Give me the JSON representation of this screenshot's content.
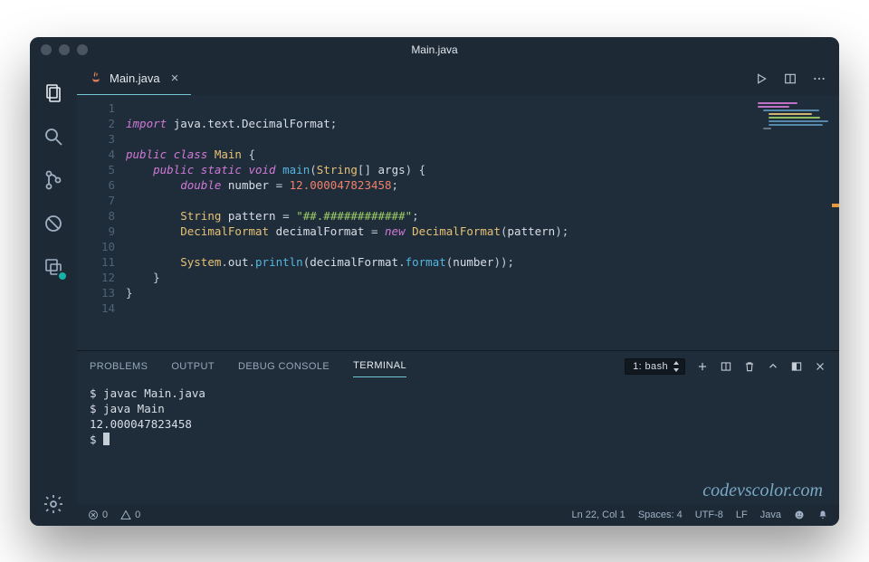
{
  "window": {
    "title": "Main.java"
  },
  "tabs": {
    "open": {
      "filename": "Main.java"
    },
    "actions": {
      "run": "run-icon",
      "split": "split-icon",
      "more": "more-icon"
    }
  },
  "activitybar": {
    "items": [
      "explorer-icon",
      "search-icon",
      "source-control-icon",
      "debug-icon",
      "remote-icon"
    ],
    "bottom": [
      "settings-gear-icon"
    ]
  },
  "editor": {
    "line_numbers": [
      "1",
      "2",
      "3",
      "4",
      "5",
      "6",
      "7",
      "8",
      "9",
      "10",
      "11",
      "12",
      "13",
      "14"
    ],
    "code": {
      "l2_import": "import",
      "l2_pkg": "java.text.DecimalFormat",
      "l4_public": "public",
      "l4_class": "class",
      "l4_name": "Main",
      "l5_public": "public",
      "l5_static": "static",
      "l5_void": "void",
      "l5_main": "main",
      "l5_String": "String",
      "l5_args": "args",
      "l6_double": "double",
      "l6_var": "number",
      "l6_eq": "=",
      "l6_val": "12.000047823458",
      "l8_String": "String",
      "l8_var": "pattern",
      "l8_eq": "=",
      "l8_val": "\"##.############\"",
      "l9_Type": "DecimalFormat",
      "l9_var": "decimalFormat",
      "l9_eq": "=",
      "l9_new": "new",
      "l9_ctor": "DecimalFormat",
      "l9_arg": "pattern",
      "l11_System": "System",
      "l11_out": "out",
      "l11_println": "println",
      "l11_df": "decimalFormat",
      "l11_format": "format",
      "l11_arg": "number"
    }
  },
  "panel": {
    "tabs": {
      "problems": "PROBLEMS",
      "output": "OUTPUT",
      "debug": "DEBUG CONSOLE",
      "terminal": "TERMINAL"
    },
    "terminal_select": "1: bash",
    "terminal_lines": [
      "$ javac Main.java",
      "$ java Main",
      "12.000047823458",
      "$ "
    ]
  },
  "watermark": "codevscolor.com",
  "statusbar": {
    "errors": "0",
    "warnings": "0",
    "position": "Ln 22, Col 1",
    "spaces": "Spaces: 4",
    "encoding": "UTF-8",
    "eol": "LF",
    "language": "Java"
  }
}
